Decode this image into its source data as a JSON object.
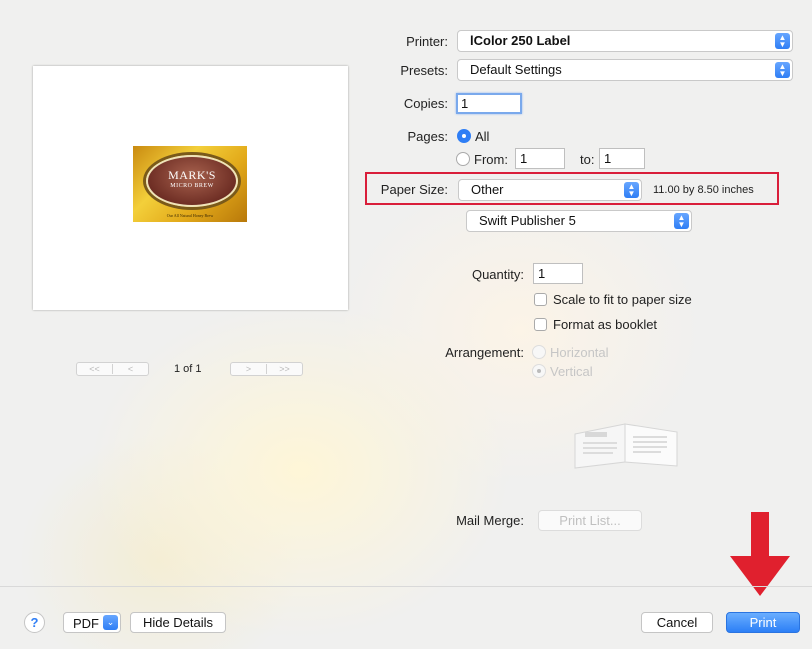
{
  "printer": {
    "label": "Printer:",
    "value": "lColor 250 Label"
  },
  "presets": {
    "label": "Presets:",
    "value": "Default Settings"
  },
  "copies": {
    "label": "Copies:",
    "value": "1"
  },
  "pages": {
    "label": "Pages:",
    "all_label": "All",
    "from_label": "From:",
    "from_value": "1",
    "to_label": "to:",
    "to_value": "1"
  },
  "paper_size": {
    "label": "Paper Size:",
    "value": "Other",
    "dimensions": "11.00 by 8.50 inches"
  },
  "app_panel": {
    "value": "Swift Publisher 5"
  },
  "quantity": {
    "label": "Quantity:",
    "value": "1"
  },
  "options": {
    "scale_to_fit": "Scale to fit to paper size",
    "format_booklet": "Format as booklet"
  },
  "arrangement": {
    "label": "Arrangement:",
    "horizontal": "Horizontal",
    "vertical": "Vertical"
  },
  "mail_merge": {
    "label": "Mail Merge:",
    "button": "Print List..."
  },
  "preview": {
    "page_indicator": "1 of 1",
    "first_prev": [
      "<<",
      "<"
    ],
    "next_last": [
      ">",
      ">>"
    ],
    "label_title": "MARK'S",
    "label_subtitle": "MICRO BREW",
    "label_tagline": "Our All Natural Honey Brew"
  },
  "footer": {
    "help": "?",
    "pdf": "PDF",
    "hide_details": "Hide Details",
    "cancel": "Cancel",
    "print": "Print"
  },
  "colors": {
    "accent": "#2f7ef5",
    "highlight_box": "#d91e3a",
    "arrow": "#e0202e"
  },
  "icons": {
    "help": "question-icon",
    "popup": "up-down-chevron-icon",
    "pdf_menu": "chevron-down-icon",
    "annotation": "down-arrow-icon"
  }
}
